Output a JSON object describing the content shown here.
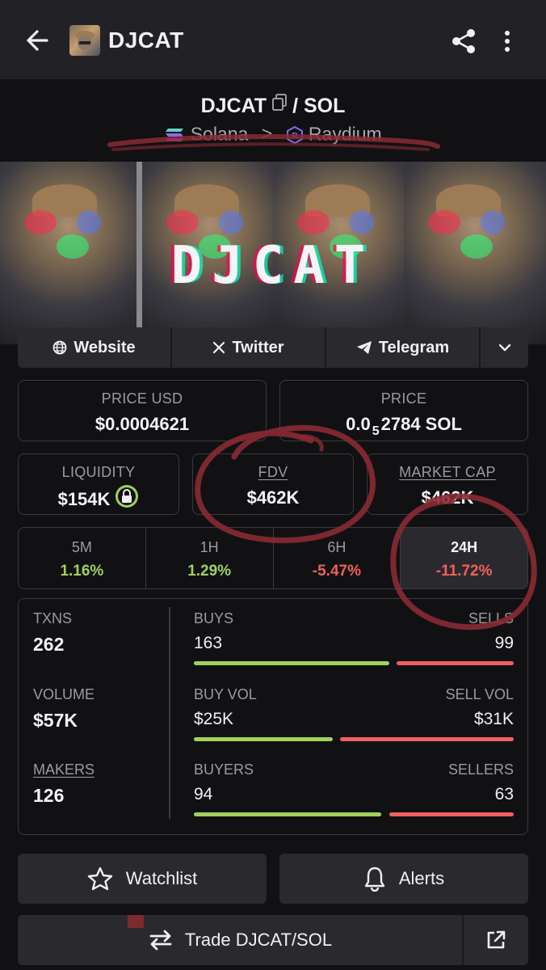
{
  "header": {
    "title": "DJCAT",
    "back_icon": "arrow-left-icon",
    "share_icon": "share-icon",
    "more_icon": "more-vertical-icon"
  },
  "pair": {
    "base": "DJCAT",
    "separator": "/",
    "quote": "SOL",
    "chain": "Solana",
    "dex": "Raydium",
    "chevron": ">"
  },
  "banner": {
    "text": "DJCAT"
  },
  "links": {
    "website": "Website",
    "twitter": "Twitter",
    "telegram": "Telegram"
  },
  "price": {
    "usd_label": "PRICE USD",
    "usd_value": "$0.0004621",
    "native_label": "PRICE",
    "native_prefix": "0.0",
    "native_sub": "5",
    "native_rest": "2784 SOL"
  },
  "metrics": {
    "liquidity_label": "LIQUIDITY",
    "liquidity_value": "$154K",
    "fdv_label": "FDV",
    "fdv_value": "$462K",
    "mcap_label": "MARKET CAP",
    "mcap_value": "$462K"
  },
  "timeframes": [
    {
      "label": "5M",
      "value": "1.16%"
    },
    {
      "label": "1H",
      "value": "1.29%"
    },
    {
      "label": "6H",
      "value": "-5.47%"
    },
    {
      "label": "24H",
      "value": "-11.72%"
    }
  ],
  "stats": {
    "txns_label": "TXNS",
    "txns_value": "262",
    "volume_label": "VOLUME",
    "volume_value": "$57K",
    "makers_label": "MAKERS",
    "makers_value": "126",
    "buys_label": "BUYS",
    "buys_value": "163",
    "sells_label": "SELLS",
    "sells_value": "99",
    "buy_vol_label": "BUY VOL",
    "buy_vol_value": "$25K",
    "sell_vol_label": "SELL VOL",
    "sell_vol_value": "$31K",
    "buyers_label": "BUYERS",
    "buyers_value": "94",
    "sellers_label": "SELLERS",
    "sellers_value": "63",
    "buys_fraction": 0.622,
    "buy_vol_fraction": 0.446,
    "buyers_fraction": 0.599
  },
  "actions": {
    "watchlist": "Watchlist",
    "alerts": "Alerts",
    "trade": "Trade DJCAT/SOL"
  },
  "colors": {
    "positive": "#9fd15c",
    "negative": "#f0605d",
    "background": "#111114",
    "panel": "#2a2a2e"
  }
}
